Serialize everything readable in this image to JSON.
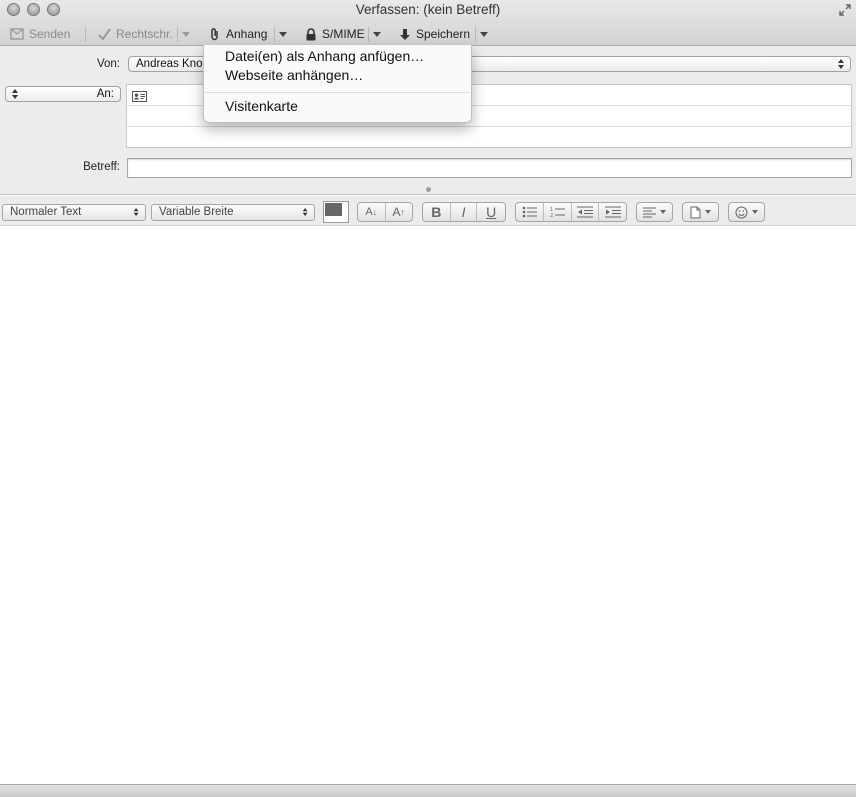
{
  "window": {
    "title": "Verfassen: (kein Betreff)"
  },
  "toolbar": {
    "send_label": "Senden",
    "spelling_label": "Rechtschr.",
    "attachment_label": "Anhang",
    "smime_label": "S/MIME",
    "save_label": "Speichern"
  },
  "attachment_menu": {
    "items": [
      {
        "label": "Datei(en) als Anhang anfügen…"
      },
      {
        "label": "Webseite anhängen…"
      },
      {
        "label": "Visitenkarte"
      }
    ]
  },
  "header": {
    "from_label": "Von:",
    "from_value": "Andreas Kno",
    "to_label": "An:",
    "subject_label": "Betreff:",
    "subject_value": ""
  },
  "format": {
    "paragraph_style": "Normaler Text",
    "font": "Variable Breite",
    "font_smaller_label": "A",
    "font_larger_label": "A",
    "bold_label": "B",
    "italic_label": "I",
    "underline_label": "U",
    "text_color": "#666666"
  }
}
